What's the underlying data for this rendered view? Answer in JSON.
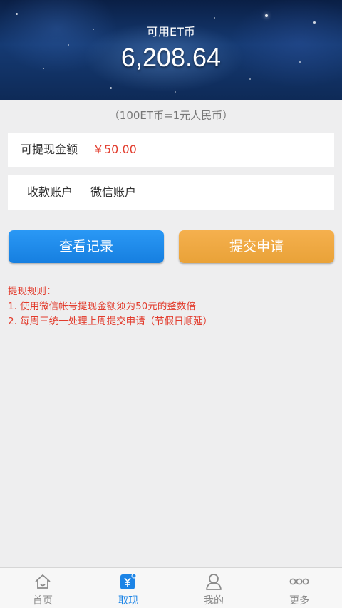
{
  "header": {
    "label": "可用ET币",
    "balance": "6,208.64"
  },
  "rate_note": "（100ET币=1元人民币）",
  "withdraw": {
    "amount_label": "可提现金额",
    "amount_value": "￥50.00",
    "account_label": "收款账户",
    "account_value": "微信账户"
  },
  "buttons": {
    "records": "查看记录",
    "submit": "提交申请"
  },
  "rules": {
    "title": "提现规则：",
    "items": [
      "1. 使用微信帐号提现金额须为50元的整数倍",
      "2. 每周三统一处理上周提交申请（节假日顺延）"
    ]
  },
  "tabbar": {
    "items": [
      {
        "label": "首页",
        "icon": "home-icon"
      },
      {
        "label": "取现",
        "icon": "yuan-icon"
      },
      {
        "label": "我的",
        "icon": "user-icon"
      },
      {
        "label": "更多",
        "icon": "more-icon"
      }
    ],
    "active_color": "#1c84e6"
  },
  "colors": {
    "accent_blue": "#1a8aee",
    "accent_orange": "#efa842",
    "rule_red": "#e23b2c"
  }
}
